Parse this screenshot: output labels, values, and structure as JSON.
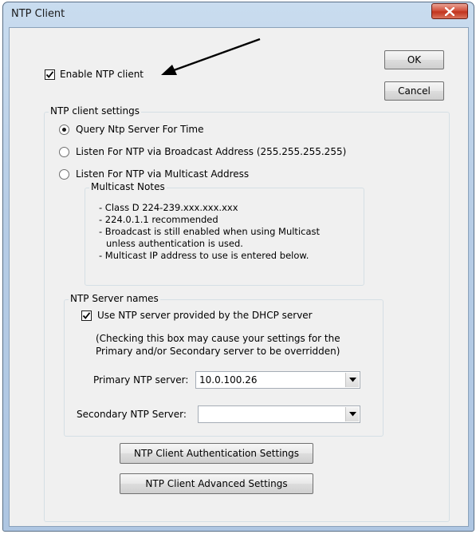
{
  "window": {
    "title": "NTP Client"
  },
  "enable": {
    "label": "Enable NTP client",
    "checked": true
  },
  "buttons": {
    "ok": "OK",
    "cancel": "Cancel"
  },
  "settings": {
    "group_label": "NTP client settings",
    "radios": [
      {
        "label": "Query Ntp Server For Time",
        "selected": true
      },
      {
        "label": "Listen For NTP via Broadcast Address (255.255.255.255)",
        "selected": false
      },
      {
        "label": "Listen For NTP via Multicast Address",
        "selected": false
      }
    ],
    "multicast_notes": {
      "label": "Multicast Notes",
      "lines": [
        "- Class D 224-239.xxx.xxx.xxx",
        "- 224.0.1.1 recommended",
        "- Broadcast is still enabled when using Multicast",
        "unless authentication is used.",
        "- Multicast IP address to use is entered below."
      ]
    },
    "server_names": {
      "label": "NTP Server names",
      "dhcp_label": "Use NTP server provided by the DHCP server",
      "dhcp_checked": true,
      "dhcp_note_1": "(Checking this box may cause your settings for the",
      "dhcp_note_2": "Primary and/or Secondary server to be overridden)",
      "primary_label": "Primary NTP server:",
      "primary_value": "10.0.100.26",
      "secondary_label": "Secondary NTP Server:",
      "secondary_value": ""
    },
    "auth_button": "NTP Client Authentication Settings",
    "advanced_button": "NTP Client Advanced Settings"
  },
  "colors": {
    "close_button": "#c2341d",
    "titlebar": "#b7cde6",
    "dialog_bg": "#f0f0f0"
  },
  "icons": {
    "close": "close-icon",
    "dropdown": "chevron-down-icon",
    "annotation": "arrow-annotation"
  }
}
